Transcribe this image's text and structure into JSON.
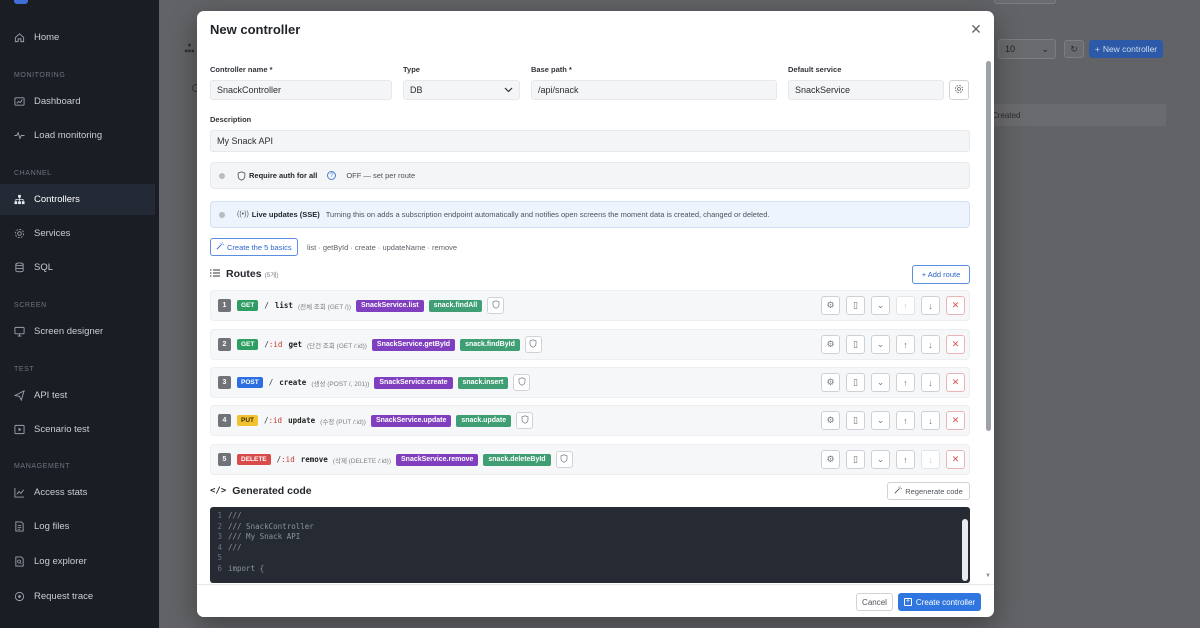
{
  "sidebar": {
    "sections": [
      "MONITORING",
      "CHANNEL",
      "SCREEN",
      "TEST",
      "MANAGEMENT"
    ],
    "items": [
      {
        "label": "Home",
        "icon": "home-icon"
      },
      {
        "label": "Dashboard",
        "icon": "dashboard-icon"
      },
      {
        "label": "Load monitoring",
        "icon": "pulse-icon"
      },
      {
        "label": "Controllers",
        "icon": "hierarchy-icon",
        "active": true
      },
      {
        "label": "Services",
        "icon": "gear-icon"
      },
      {
        "label": "SQL",
        "icon": "database-icon"
      },
      {
        "label": "Screen designer",
        "icon": "monitor-icon"
      },
      {
        "label": "API test",
        "icon": "send-icon"
      },
      {
        "label": "Scenario test",
        "icon": "play-icon"
      },
      {
        "label": "Access stats",
        "icon": "chart-icon"
      },
      {
        "label": "Log files",
        "icon": "file-icon"
      },
      {
        "label": "Log explorer",
        "icon": "file-search-icon"
      },
      {
        "label": "Request trace",
        "icon": "target-icon"
      }
    ]
  },
  "background": {
    "page_size": "10",
    "new_button": "New controller",
    "table_header": "Created"
  },
  "modal": {
    "title": "New controller",
    "fields": {
      "name_label": "Controller name *",
      "name_value": "SnackController",
      "type_label": "Type",
      "type_value": "DB",
      "base_path_label": "Base path *",
      "base_path_value": "/api/snack",
      "service_label": "Default service",
      "service_value": "SnackService",
      "description_label": "Description",
      "description_value": "My Snack API"
    },
    "auth": {
      "label": "Require auth for all",
      "hint": "OFF — set per route"
    },
    "live": {
      "label": "Live updates (SSE)",
      "hint": "Turning this on adds a subscription endpoint automatically and notifies open screens the moment data is created, changed or deleted."
    },
    "basics": {
      "button": "Create the 5 basics",
      "hint": "list · getById · create · updateName · remove"
    },
    "routes_title": "Routes",
    "routes_count": "(5개)",
    "add_route": "+ Add route",
    "routes": [
      {
        "num": "1",
        "method": "GET",
        "path_slash": "/",
        "path_param": "",
        "fn": "list",
        "desc": "(전체 조회 (GET /))",
        "service": "SnackService.list",
        "sql": "snack.findAll"
      },
      {
        "num": "2",
        "method": "GET",
        "path_slash": "/",
        "path_param": ":id",
        "fn": "get",
        "desc": "(단건 조회 (GET /:id))",
        "service": "SnackService.getById",
        "sql": "snack.findById"
      },
      {
        "num": "3",
        "method": "POST",
        "path_slash": "/",
        "path_param": "",
        "fn": "create",
        "desc": "(생성 (POST /, 201))",
        "service": "SnackService.create",
        "sql": "snack.insert"
      },
      {
        "num": "4",
        "method": "PUT",
        "path_slash": "/",
        "path_param": ":id",
        "fn": "update",
        "desc": "(수정 (PUT /:id))",
        "service": "SnackService.update",
        "sql": "snack.update"
      },
      {
        "num": "5",
        "method": "DELETE",
        "path_slash": "/",
        "path_param": ":id",
        "fn": "remove",
        "desc": "(삭제 (DELETE /:id))",
        "service": "SnackService.remove",
        "sql": "snack.deleteById"
      }
    ],
    "generated_title": "Generated code",
    "regenerate": "Regenerate code",
    "code_lines": [
      {
        "n": "1",
        "text": "///"
      },
      {
        "n": "2",
        "text": "/// SnackController"
      },
      {
        "n": "3",
        "text": "/// My Snack API"
      },
      {
        "n": "4",
        "text": "///"
      },
      {
        "n": "5",
        "text": ""
      },
      {
        "n": "6",
        "text": "import {"
      }
    ],
    "cancel": "Cancel",
    "create": "Create controller"
  }
}
